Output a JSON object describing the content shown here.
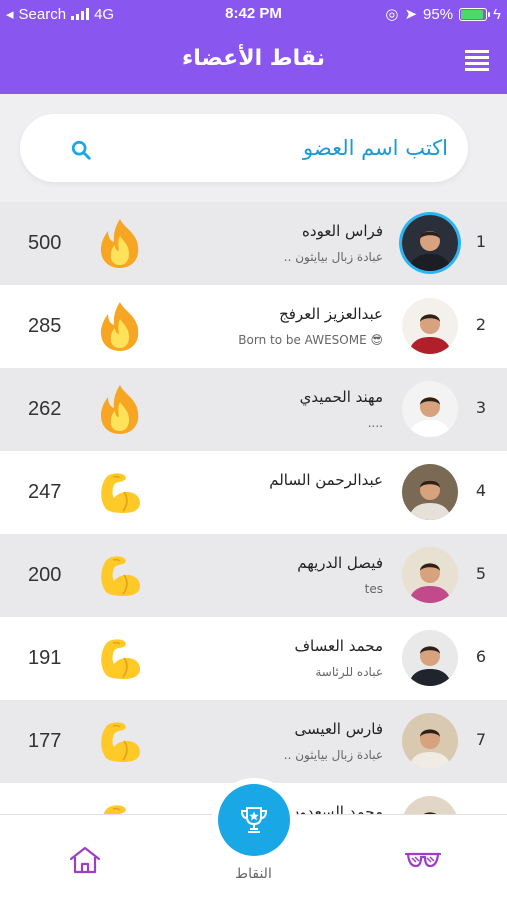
{
  "status_bar": {
    "carrier": "Search",
    "network": "4G",
    "time": "8:42 PM",
    "battery": "95%"
  },
  "nav": {
    "title": "نقاط الأعضاء"
  },
  "search": {
    "placeholder": "اكتب اسم العضو"
  },
  "members": [
    {
      "rank": "1",
      "name": "فراس العوده",
      "subtitle": "عبادة زبال بيايثون ..",
      "points": "500",
      "badge": "fire-icon",
      "avatar_color": "#2a2f3a",
      "shirt": "#1b1e25"
    },
    {
      "rank": "2",
      "name": "عبدالعزيز العرفج",
      "subtitle": "😎 Born to be AWESOME",
      "points": "285",
      "badge": "fire-icon",
      "avatar_color": "#f4f1ec",
      "shirt": "#b0202a"
    },
    {
      "rank": "3",
      "name": "مهند الحميدي",
      "subtitle": "....",
      "points": "262",
      "badge": "fire-icon",
      "avatar_color": "#f3f3f3",
      "shirt": "#ffffff"
    },
    {
      "rank": "4",
      "name": "عبدالرحمن السالم",
      "subtitle": "",
      "points": "247",
      "badge": "flexed-biceps-icon",
      "avatar_color": "#7a6a55",
      "shirt": "#e6e1d8"
    },
    {
      "rank": "5",
      "name": "فيصل الدريهم",
      "subtitle": "tes",
      "points": "200",
      "badge": "flexed-biceps-icon",
      "avatar_color": "#e8e0d0",
      "shirt": "#c04a8a"
    },
    {
      "rank": "6",
      "name": "محمد العساف",
      "subtitle": "عباده للرئاسة",
      "points": "191",
      "badge": "flexed-biceps-icon",
      "avatar_color": "#e9e9e9",
      "shirt": "#20242c"
    },
    {
      "rank": "7",
      "name": "فارس العيسى",
      "subtitle": "عبادة زبال بيايثون ..",
      "points": "177",
      "badge": "flexed-biceps-icon",
      "avatar_color": "#d8c9b0",
      "shirt": "#f0ece4"
    },
    {
      "rank": "",
      "name": "محمد السعدون",
      "subtitle": "",
      "points": "",
      "badge": "flexed-biceps-icon",
      "avatar_color": "#e2d6c6",
      "shirt": "#c9302c"
    }
  ],
  "tab_bar": {
    "points_label": "النقاط"
  },
  "colors": {
    "header": "#8a56f0",
    "accent": "#1aa7e6",
    "tab_icon": "#9b3fc8"
  }
}
